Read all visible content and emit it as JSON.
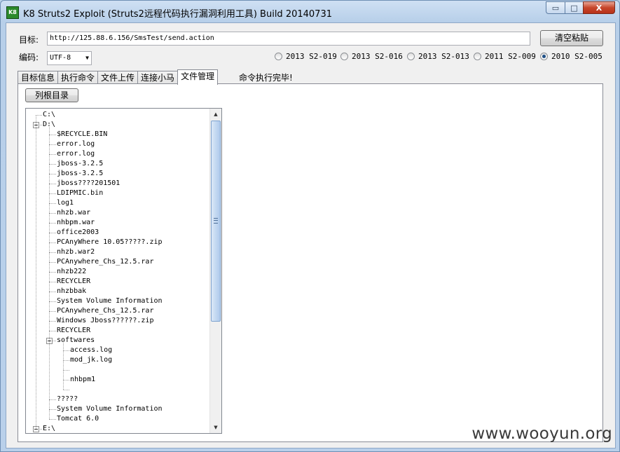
{
  "window": {
    "title": "K8 Struts2 Exploit (Struts2远程代码执行漏洞利用工具)  Build 20140731",
    "icon_label": "K8",
    "minimize": "▭",
    "maximize": "□",
    "close": "X"
  },
  "target": {
    "label": "目标:",
    "value": "http://125.88.6.156/SmsTest/send.action"
  },
  "clear_button": "清空粘贴",
  "encoding": {
    "label": "编码:",
    "value": "UTF-8"
  },
  "vulns": [
    {
      "label": "2013 S2-019",
      "checked": false
    },
    {
      "label": "2013 S2-016",
      "checked": false
    },
    {
      "label": "2013 S2-013",
      "checked": false
    },
    {
      "label": "2011 S2-009",
      "checked": false
    },
    {
      "label": "2010 S2-005",
      "checked": true
    }
  ],
  "tabs": [
    "目标信息",
    "执行命令",
    "文件上传",
    "连接小马",
    "文件管理"
  ],
  "active_tab": 4,
  "status_text": "命令执行完毕!",
  "list_root_button": "列根目录",
  "tree": [
    {
      "label": "C:\\",
      "level": 0,
      "expander": false
    },
    {
      "label": "D:\\",
      "level": 0,
      "expander": true
    },
    {
      "label": "$RECYCLE.BIN",
      "level": 1
    },
    {
      "label": "error.log",
      "level": 1
    },
    {
      "label": "error.log",
      "level": 1
    },
    {
      "label": "jboss-3.2.5",
      "level": 1
    },
    {
      "label": "jboss-3.2.5",
      "level": 1
    },
    {
      "label": "jboss????201501",
      "level": 1
    },
    {
      "label": "LDIPMIC.bin",
      "level": 1
    },
    {
      "label": "log1",
      "level": 1
    },
    {
      "label": "nhzb.war",
      "level": 1
    },
    {
      "label": "nhbpm.war",
      "level": 1
    },
    {
      "label": "office2003",
      "level": 1
    },
    {
      "label": "PCAnyWhere 10.05?????.zip",
      "level": 1
    },
    {
      "label": "nhzb.war2",
      "level": 1
    },
    {
      "label": "PCAnywhere_Chs_12.5.rar",
      "level": 1
    },
    {
      "label": "nhzb222",
      "level": 1
    },
    {
      "label": "RECYCLER",
      "level": 1
    },
    {
      "label": "nhzbbak",
      "level": 1
    },
    {
      "label": "System Volume Information",
      "level": 1
    },
    {
      "label": "PCAnywhere_Chs_12.5.rar",
      "level": 1
    },
    {
      "label": "Windows Jboss??????.zip",
      "level": 1
    },
    {
      "label": "RECYCLER",
      "level": 1
    },
    {
      "label": "softwares",
      "level": 1,
      "expander": true
    },
    {
      "label": "access.log",
      "level": 2
    },
    {
      "label": "mod_jk.log",
      "level": 2
    },
    {
      "label": "",
      "level": 2
    },
    {
      "label": "nhbpm1",
      "level": 2
    },
    {
      "label": "",
      "level": 2
    },
    {
      "label": "?????",
      "level": 1
    },
    {
      "label": "System Volume Information",
      "level": 1
    },
    {
      "label": "Tomcat 6.0",
      "level": 1
    },
    {
      "label": "E:\\",
      "level": 0,
      "expander": true
    }
  ],
  "watermark": "www.wooyun.org"
}
